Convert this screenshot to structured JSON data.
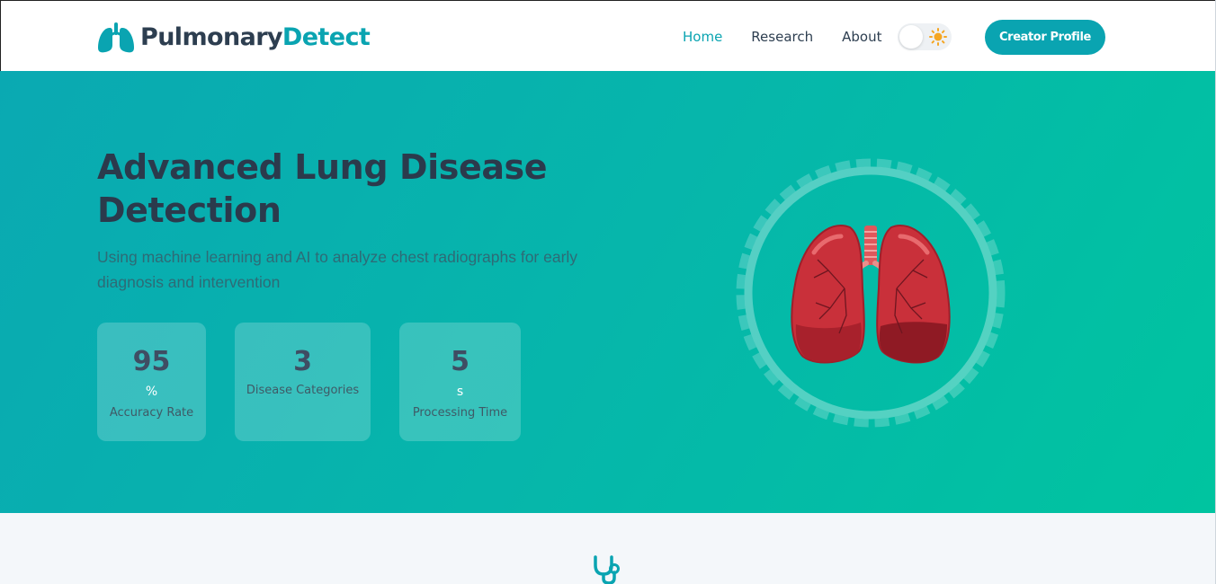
{
  "header": {
    "logo": {
      "part1": "Pulmonary",
      "part2": "Detect",
      "icon": "lungs-icon"
    },
    "nav": [
      {
        "label": "Home",
        "active": true
      },
      {
        "label": "Research",
        "active": false
      },
      {
        "label": "About",
        "active": false
      }
    ],
    "theme_toggle": {
      "icon": "sun-icon",
      "mode": "light"
    },
    "cta_label": "Creator Profile"
  },
  "hero": {
    "title": "Advanced Lung Disease Detection",
    "subtitle": "Using machine learning and AI to analyze chest radiographs for early diagnosis and intervention",
    "stats": [
      {
        "value": "95",
        "unit": "%",
        "label": "Accuracy Rate"
      },
      {
        "value": "3",
        "unit": "",
        "label": "Disease Categories"
      },
      {
        "value": "5",
        "unit": "s",
        "label": "Processing Time"
      }
    ],
    "illustration": "lungs-illustration"
  },
  "section": {
    "icon": "stethoscope-icon"
  },
  "colors": {
    "brand": "#0aa4b1",
    "dark": "#2d3e50",
    "hero_start": "#0aa9b2",
    "hero_end": "#00c4a0",
    "lung_red": "#c9303a"
  }
}
